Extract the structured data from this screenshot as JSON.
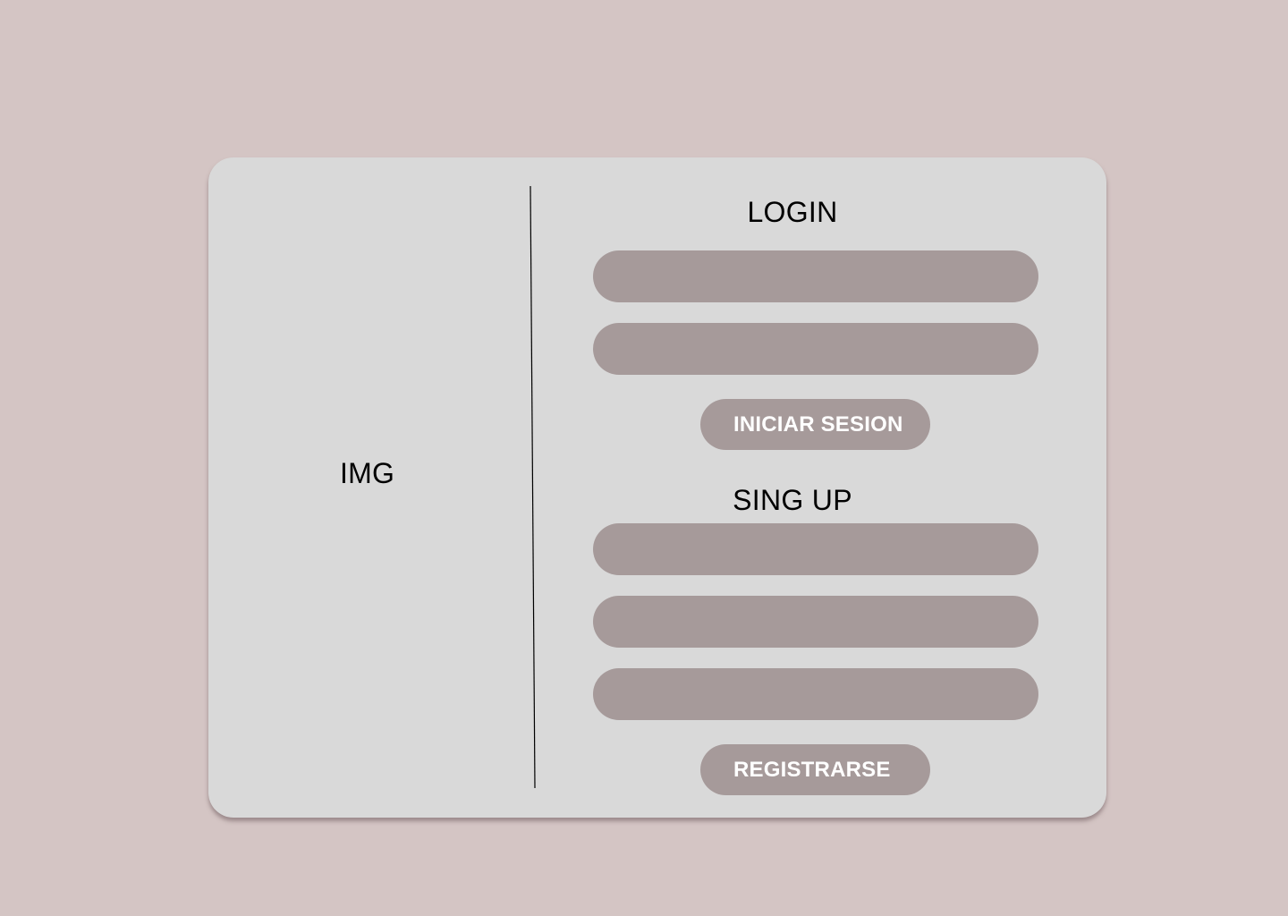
{
  "image_panel": {
    "label": "IMG"
  },
  "login": {
    "title": "LOGIN",
    "fields": [
      {
        "value": "",
        "placeholder": ""
      },
      {
        "value": "",
        "placeholder": ""
      }
    ],
    "submit_label": "INICIAR SESION"
  },
  "signup": {
    "title": "SING UP",
    "fields": [
      {
        "value": "",
        "placeholder": ""
      },
      {
        "value": "",
        "placeholder": ""
      },
      {
        "value": "",
        "placeholder": ""
      }
    ],
    "submit_label": "REGISTRARSE"
  },
  "colors": {
    "background": "#d4c5c4",
    "card": "#d9d9d9",
    "field": "#a69a9a",
    "button_text": "#ffffff",
    "title_text": "#000000"
  }
}
